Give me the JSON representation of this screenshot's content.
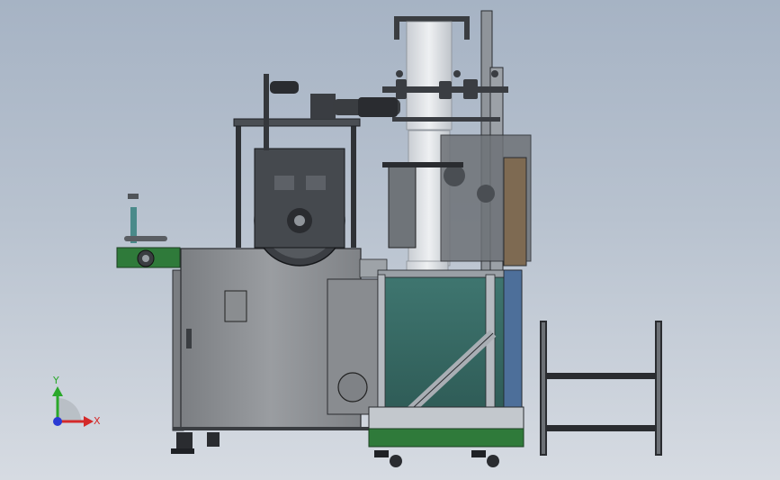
{
  "viewport": {
    "background_top": "#a6b3c4",
    "background_bottom": "#d6dbe2"
  },
  "triad": {
    "x_label": "X",
    "y_label": "Y",
    "x_color": "#d42a2a",
    "y_color": "#2aa82a",
    "z_color": "#2a3ad4"
  },
  "colors": {
    "frame_green": "#2f7a3a",
    "panel_teal": "#3d6f68",
    "cabinet_gray": "#8a8d90",
    "metal_light": "#c7ccd2",
    "metal_dark": "#2a2c30",
    "film_white": "#e3e6ea"
  },
  "icons": {
    "part": "assembly-model-icon",
    "triad": "coordinate-triad-icon"
  }
}
